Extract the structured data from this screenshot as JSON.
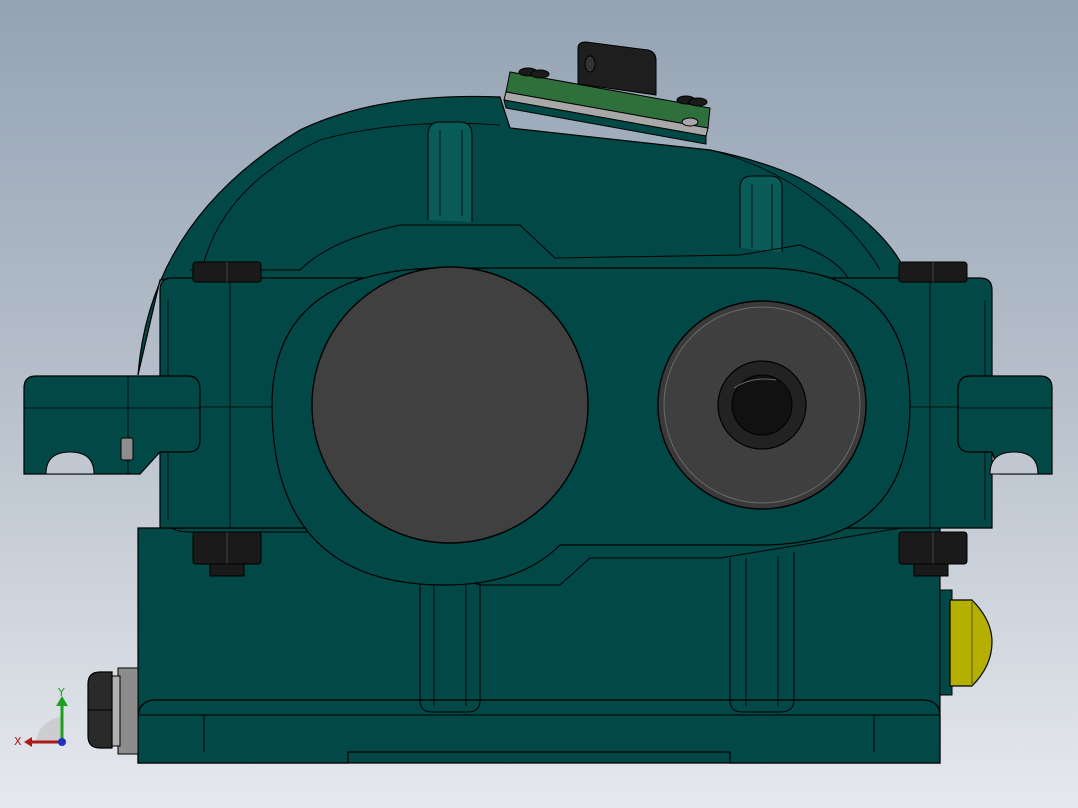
{
  "triad": {
    "x_label": "X",
    "y_label": "Y",
    "x_color": "#b01818",
    "y_color": "#20a020",
    "z_color": "#2030c0"
  },
  "colors": {
    "housing": "#024846",
    "housing_light": "#0a5c59",
    "edge": "#000000",
    "bearing_cover_large": "#404040",
    "bearing_cover_small": "#3a3a3a",
    "drain_plug": "#2a2a2a",
    "oil_gauge": "#b5b000",
    "inspection_cover": "#2f6f3c",
    "gasket": "#a8a8a8",
    "background_top": "#94a3b4",
    "background_bottom": "#e6e9ee"
  }
}
